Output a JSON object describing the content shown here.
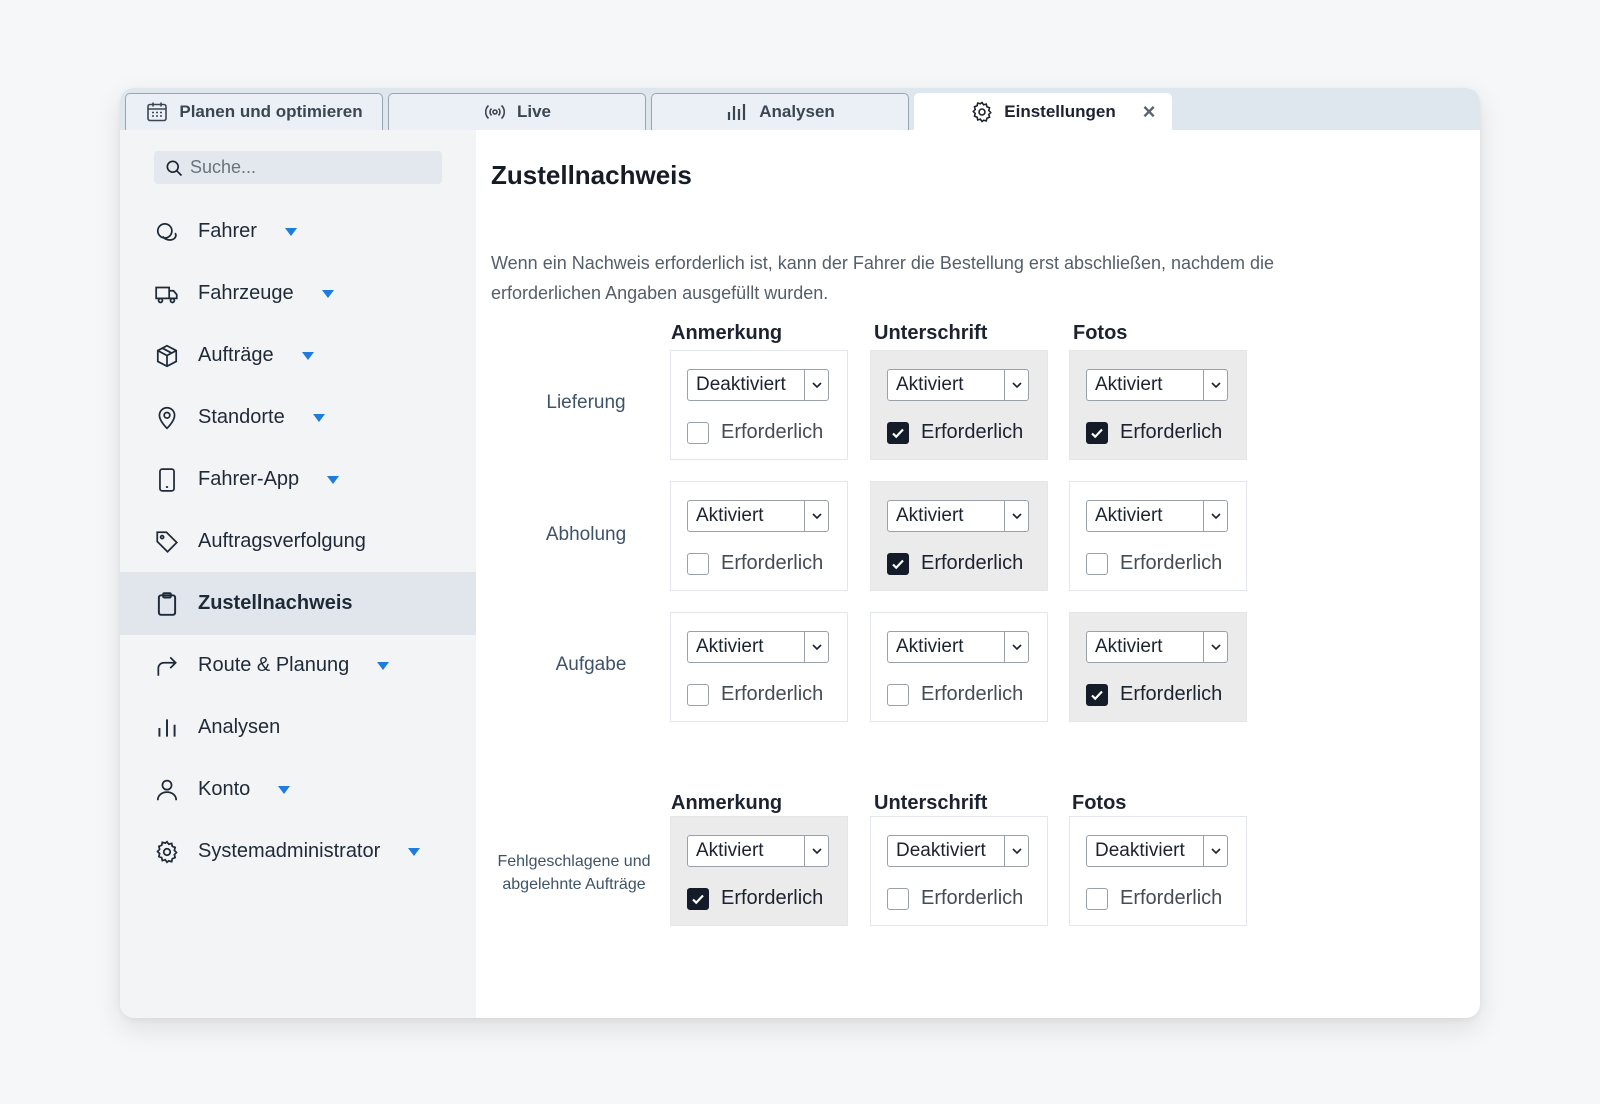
{
  "tabs": [
    {
      "label": "Planen und optimieren",
      "icon": "calendar-icon"
    },
    {
      "label": "Live",
      "icon": "broadcast-icon"
    },
    {
      "label": "Analysen",
      "icon": "bar-chart-icon"
    },
    {
      "label": "Einstellungen",
      "icon": "gear-icon",
      "active": true,
      "close": "×"
    }
  ],
  "sidebar": {
    "search_placeholder": "Suche...",
    "items": [
      {
        "label": "Fahrer",
        "icon": "driver-icon",
        "caret": true
      },
      {
        "label": "Fahrzeuge",
        "icon": "truck-icon",
        "caret": true
      },
      {
        "label": "Aufträge",
        "icon": "box-icon",
        "caret": true
      },
      {
        "label": "Standorte",
        "icon": "location-pin-icon",
        "caret": true
      },
      {
        "label": "Fahrer-App",
        "icon": "phone-icon",
        "caret": true
      },
      {
        "label": "Auftragsverfolgung",
        "icon": "tag-icon",
        "caret": false
      },
      {
        "label": "Zustellnachweis",
        "icon": "clipboard-icon",
        "caret": false,
        "active": true
      },
      {
        "label": "Route & Planung",
        "icon": "route-arrow-icon",
        "caret": true
      },
      {
        "label": "Analysen",
        "icon": "bar-chart-icon",
        "caret": false
      },
      {
        "label": "Konto",
        "icon": "user-icon",
        "caret": true
      },
      {
        "label": "Systemadministrator",
        "icon": "gear-icon",
        "caret": true
      }
    ]
  },
  "main": {
    "title": "Zustellnachweis",
    "description": "Wenn ein Nachweis erforderlich ist, kann der Fahrer die Bestellung erst abschließen, nachdem die erforderlichen Angaben ausgefüllt wurden.",
    "columns": [
      "Anmerkung",
      "Unterschrift",
      "Fotos"
    ],
    "checkbox_label": "Erforderlich",
    "rows": [
      {
        "label": "Lieferung",
        "cells": [
          {
            "value": "Deaktiviert",
            "required": false
          },
          {
            "value": "Aktiviert",
            "required": true
          },
          {
            "value": "Aktiviert",
            "required": true
          }
        ]
      },
      {
        "label": "Abholung",
        "cells": [
          {
            "value": "Aktiviert",
            "required": false
          },
          {
            "value": "Aktiviert",
            "required": true
          },
          {
            "value": "Aktiviert",
            "required": false
          }
        ]
      },
      {
        "label": "Aufgabe",
        "cells": [
          {
            "value": "Aktiviert",
            "required": false
          },
          {
            "value": "Aktiviert",
            "required": false
          },
          {
            "value": "Aktiviert",
            "required": true
          }
        ]
      }
    ],
    "failed": {
      "columns": [
        "Anmerkung",
        "Unterschrift",
        "Fotos"
      ],
      "label_line1": "Fehlgeschlagene und",
      "label_line2": "abgelehnte Aufträge",
      "cells": [
        {
          "value": "Aktiviert",
          "required": true
        },
        {
          "value": "Deaktiviert",
          "required": false
        },
        {
          "value": "Deaktiviert",
          "required": false
        }
      ]
    }
  },
  "colors": {
    "accent": "#1e7be0",
    "checked": "#141c2a",
    "active_bg": "#e0e6ec"
  }
}
